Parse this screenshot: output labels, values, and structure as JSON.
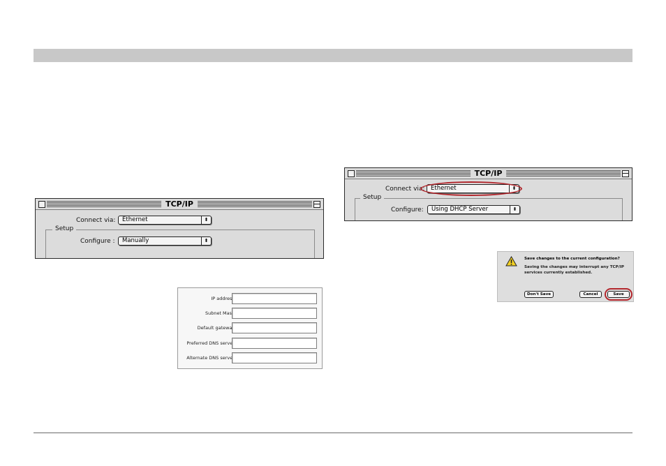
{
  "window_left": {
    "title": "TCP/IP",
    "connect_via_label": "Connect via:",
    "connect_via_value": "Ethernet",
    "setup_legend": "Setup",
    "configure_label": "Configure :",
    "configure_value": "Manually"
  },
  "window_right": {
    "title": "TCP/IP",
    "connect_via_label": "Connect via:",
    "connect_via_value": "Ethernet",
    "setup_legend": "Setup",
    "configure_label": "Configure:",
    "configure_value": "Using DHCP Server"
  },
  "ip_form": {
    "fields": [
      {
        "label": "IP address:"
      },
      {
        "label": "Subnet Mask:"
      },
      {
        "label": "Default gateway:"
      },
      {
        "label": "Preferred DNS server:"
      },
      {
        "label": "Alternate DNS server:"
      }
    ]
  },
  "dialog": {
    "title": "Save changes to the current configuration?",
    "message": "Saving the changes may interrupt any TCP/IP services currently established.",
    "dont_save_label": "Don't Save",
    "cancel_label": "Cancel",
    "save_label": "Save",
    "icon": "warning-icon"
  },
  "colors": {
    "header_bar": "#c8c8c8",
    "highlight": "#b2262c",
    "window_bg": "#dcdcdc"
  }
}
